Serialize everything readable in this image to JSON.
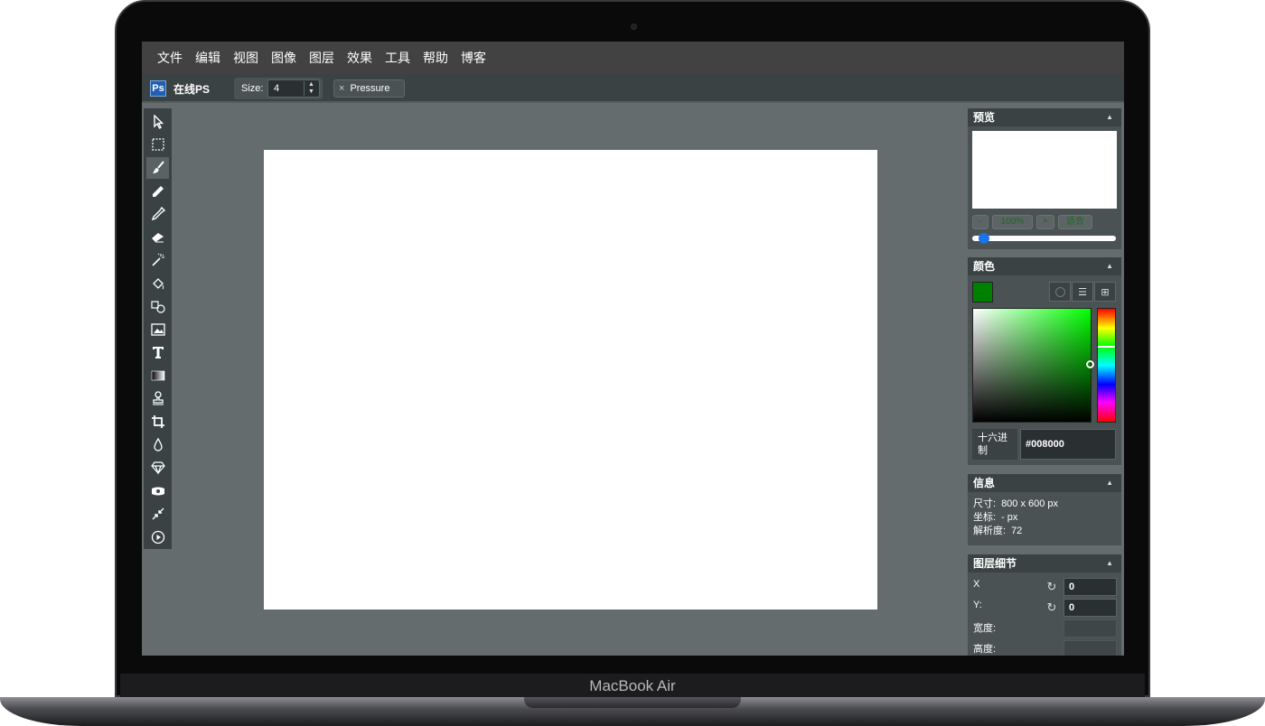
{
  "device": {
    "label": "MacBook Air"
  },
  "menu": [
    "文件",
    "编辑",
    "视图",
    "图像",
    "图层",
    "效果",
    "工具",
    "帮助",
    "博客"
  ],
  "toolbar": {
    "logo_glyph": "Ps",
    "app_name": "在线PS",
    "size_label": "Size:",
    "size_value": "4",
    "pressure_close": "×",
    "pressure_label": "Pressure"
  },
  "tools": [
    {
      "name": "select-icon"
    },
    {
      "name": "marquee-icon"
    },
    {
      "name": "brush-icon"
    },
    {
      "name": "pencil-icon"
    },
    {
      "name": "eyedropper-icon"
    },
    {
      "name": "eraser-icon"
    },
    {
      "name": "magic-wand-icon"
    },
    {
      "name": "fill-bucket-icon"
    },
    {
      "name": "shapes-icon"
    },
    {
      "name": "image-icon"
    },
    {
      "name": "text-icon"
    },
    {
      "name": "gradient-icon"
    },
    {
      "name": "clone-stamp-icon"
    },
    {
      "name": "crop-icon"
    },
    {
      "name": "blur-drop-icon"
    },
    {
      "name": "sharpen-icon"
    },
    {
      "name": "bulge-icon"
    },
    {
      "name": "resize-icon"
    },
    {
      "name": "animation-play-icon"
    }
  ],
  "preview": {
    "title": "预览",
    "zoom_out": "-",
    "zoom_value": "100%",
    "zoom_in": "+",
    "fit": "适合",
    "zoom_fraction": 0.05
  },
  "color": {
    "title": "颜色",
    "current": "#008000",
    "hex_label": "十六进制",
    "hex_value": "#008000"
  },
  "info": {
    "title": "信息",
    "size_key": "尺寸:",
    "size_value": "800 x 600 px",
    "coord_key": "坐标:",
    "coord_value": "- px",
    "res_key": "解析度:",
    "res_value": "72"
  },
  "layer": {
    "title": "图层细节",
    "x_label": "X",
    "x_value": "0",
    "y_label": "Y:",
    "y_value": "0",
    "width_label": "宽度:",
    "height_label": "高度:"
  }
}
